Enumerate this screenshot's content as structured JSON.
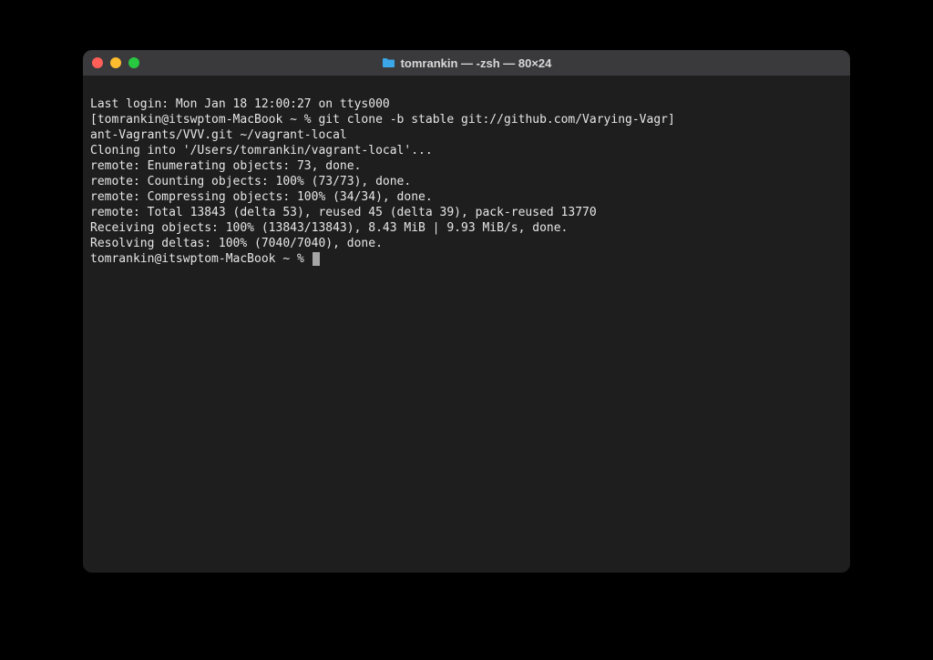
{
  "window": {
    "title": "tomrankin — -zsh — 80×24"
  },
  "terminal": {
    "last_login": "Last login: Mon Jan 18 12:00:27 on ttys000",
    "prompt1_open": "[",
    "prompt1_host": "tomrankin@itswptom-MacBook ~ % ",
    "prompt1_cmd_line1": "git clone -b stable git://github.com/Varying-Vagr",
    "prompt1_close": "]",
    "prompt1_cmd_line2": "ant-Vagrants/VVV.git ~/vagrant-local",
    "out1": "Cloning into '/Users/tomrankin/vagrant-local'...",
    "out2": "remote: Enumerating objects: 73, done.",
    "out3": "remote: Counting objects: 100% (73/73), done.",
    "out4": "remote: Compressing objects: 100% (34/34), done.",
    "out5": "remote: Total 13843 (delta 53), reused 45 (delta 39), pack-reused 13770",
    "out6": "Receiving objects: 100% (13843/13843), 8.43 MiB | 9.93 MiB/s, done.",
    "out7": "Resolving deltas: 100% (7040/7040), done.",
    "prompt2": "tomrankin@itswptom-MacBook ~ % "
  }
}
